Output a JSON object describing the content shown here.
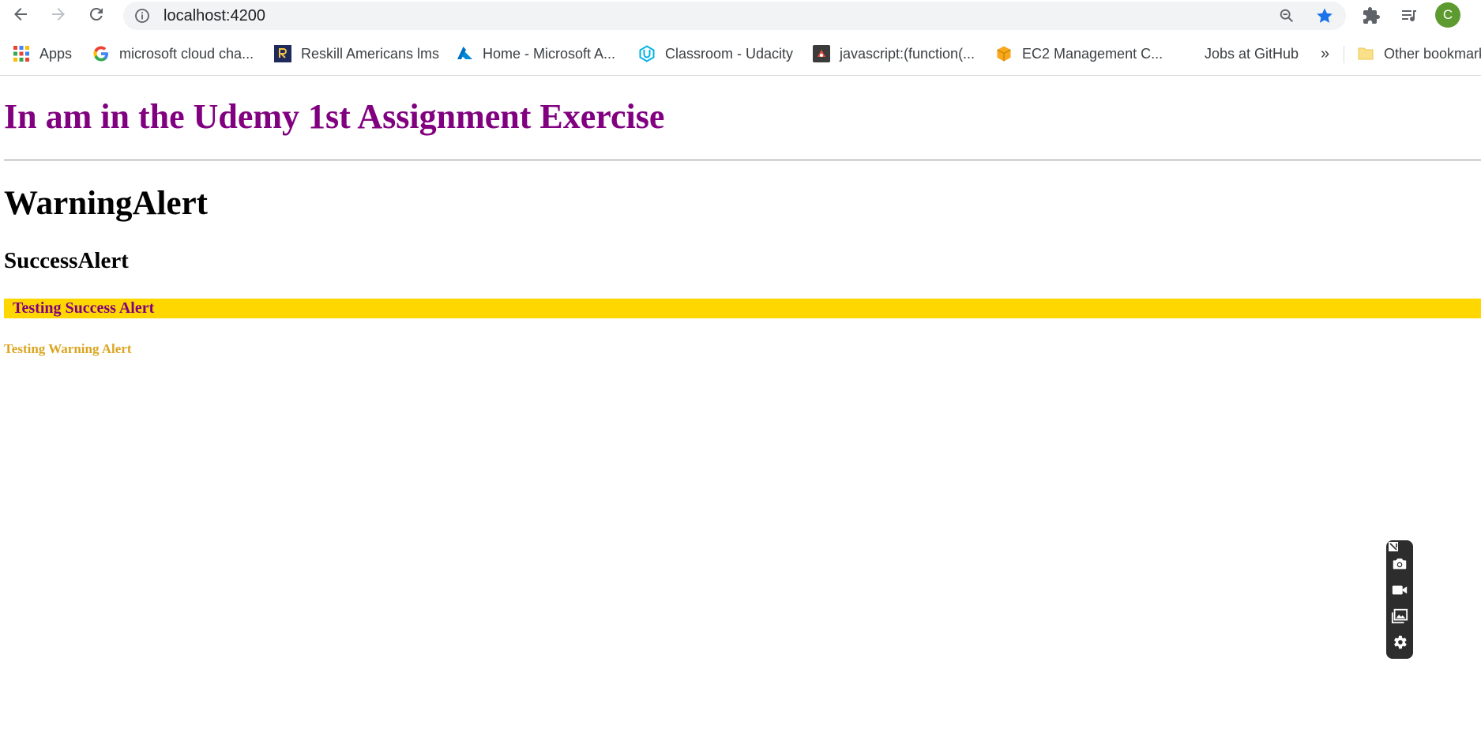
{
  "browser": {
    "url": "localhost:4200",
    "avatar_letter": "C",
    "bookmarks": {
      "apps": "Apps",
      "google": "microsoft cloud cha...",
      "reskill": "Reskill Americans lms",
      "azure": "Home - Microsoft A...",
      "udacity": "Classroom - Udacity",
      "javascript": "javascript:(function(...",
      "ec2": "EC2 Management C...",
      "github": "Jobs at GitHub",
      "overflow": "»",
      "other": "Other bookmarks"
    }
  },
  "page": {
    "heading": "In am in the Udemy 1st Assignment Exercise",
    "warning_title": "WarningAlert",
    "success_title": "SuccessAlert",
    "success_message": "Testing Success Alert",
    "warning_message": "Testing Warning Alert"
  },
  "colors": {
    "heading": "#800080",
    "success_bg": "#ffd700",
    "success_text": "#800080",
    "warning_text": "#daa520"
  },
  "icons": {
    "capture_widget": [
      "pin-icon",
      "camera-icon",
      "video-icon",
      "gallery-icon",
      "settings-icon"
    ]
  }
}
